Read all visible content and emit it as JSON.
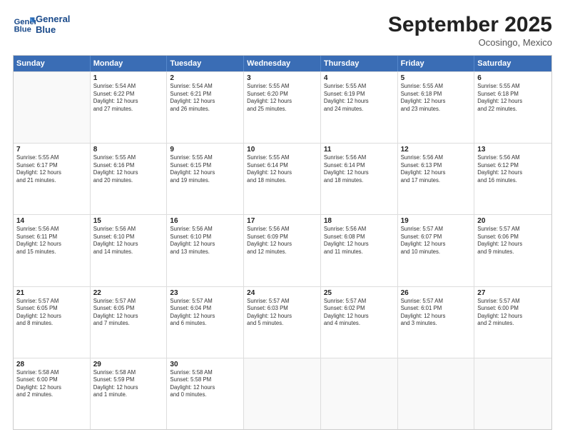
{
  "header": {
    "logo_line1": "General",
    "logo_line2": "Blue",
    "month": "September 2025",
    "location": "Ocosingo, Mexico"
  },
  "days_of_week": [
    "Sunday",
    "Monday",
    "Tuesday",
    "Wednesday",
    "Thursday",
    "Friday",
    "Saturday"
  ],
  "weeks": [
    [
      {
        "day": "",
        "info": ""
      },
      {
        "day": "1",
        "info": "Sunrise: 5:54 AM\nSunset: 6:22 PM\nDaylight: 12 hours\nand 27 minutes."
      },
      {
        "day": "2",
        "info": "Sunrise: 5:54 AM\nSunset: 6:21 PM\nDaylight: 12 hours\nand 26 minutes."
      },
      {
        "day": "3",
        "info": "Sunrise: 5:55 AM\nSunset: 6:20 PM\nDaylight: 12 hours\nand 25 minutes."
      },
      {
        "day": "4",
        "info": "Sunrise: 5:55 AM\nSunset: 6:19 PM\nDaylight: 12 hours\nand 24 minutes."
      },
      {
        "day": "5",
        "info": "Sunrise: 5:55 AM\nSunset: 6:18 PM\nDaylight: 12 hours\nand 23 minutes."
      },
      {
        "day": "6",
        "info": "Sunrise: 5:55 AM\nSunset: 6:18 PM\nDaylight: 12 hours\nand 22 minutes."
      }
    ],
    [
      {
        "day": "7",
        "info": "Sunrise: 5:55 AM\nSunset: 6:17 PM\nDaylight: 12 hours\nand 21 minutes."
      },
      {
        "day": "8",
        "info": "Sunrise: 5:55 AM\nSunset: 6:16 PM\nDaylight: 12 hours\nand 20 minutes."
      },
      {
        "day": "9",
        "info": "Sunrise: 5:55 AM\nSunset: 6:15 PM\nDaylight: 12 hours\nand 19 minutes."
      },
      {
        "day": "10",
        "info": "Sunrise: 5:55 AM\nSunset: 6:14 PM\nDaylight: 12 hours\nand 18 minutes."
      },
      {
        "day": "11",
        "info": "Sunrise: 5:56 AM\nSunset: 6:14 PM\nDaylight: 12 hours\nand 18 minutes."
      },
      {
        "day": "12",
        "info": "Sunrise: 5:56 AM\nSunset: 6:13 PM\nDaylight: 12 hours\nand 17 minutes."
      },
      {
        "day": "13",
        "info": "Sunrise: 5:56 AM\nSunset: 6:12 PM\nDaylight: 12 hours\nand 16 minutes."
      }
    ],
    [
      {
        "day": "14",
        "info": "Sunrise: 5:56 AM\nSunset: 6:11 PM\nDaylight: 12 hours\nand 15 minutes."
      },
      {
        "day": "15",
        "info": "Sunrise: 5:56 AM\nSunset: 6:10 PM\nDaylight: 12 hours\nand 14 minutes."
      },
      {
        "day": "16",
        "info": "Sunrise: 5:56 AM\nSunset: 6:10 PM\nDaylight: 12 hours\nand 13 minutes."
      },
      {
        "day": "17",
        "info": "Sunrise: 5:56 AM\nSunset: 6:09 PM\nDaylight: 12 hours\nand 12 minutes."
      },
      {
        "day": "18",
        "info": "Sunrise: 5:56 AM\nSunset: 6:08 PM\nDaylight: 12 hours\nand 11 minutes."
      },
      {
        "day": "19",
        "info": "Sunrise: 5:57 AM\nSunset: 6:07 PM\nDaylight: 12 hours\nand 10 minutes."
      },
      {
        "day": "20",
        "info": "Sunrise: 5:57 AM\nSunset: 6:06 PM\nDaylight: 12 hours\nand 9 minutes."
      }
    ],
    [
      {
        "day": "21",
        "info": "Sunrise: 5:57 AM\nSunset: 6:05 PM\nDaylight: 12 hours\nand 8 minutes."
      },
      {
        "day": "22",
        "info": "Sunrise: 5:57 AM\nSunset: 6:05 PM\nDaylight: 12 hours\nand 7 minutes."
      },
      {
        "day": "23",
        "info": "Sunrise: 5:57 AM\nSunset: 6:04 PM\nDaylight: 12 hours\nand 6 minutes."
      },
      {
        "day": "24",
        "info": "Sunrise: 5:57 AM\nSunset: 6:03 PM\nDaylight: 12 hours\nand 5 minutes."
      },
      {
        "day": "25",
        "info": "Sunrise: 5:57 AM\nSunset: 6:02 PM\nDaylight: 12 hours\nand 4 minutes."
      },
      {
        "day": "26",
        "info": "Sunrise: 5:57 AM\nSunset: 6:01 PM\nDaylight: 12 hours\nand 3 minutes."
      },
      {
        "day": "27",
        "info": "Sunrise: 5:57 AM\nSunset: 6:00 PM\nDaylight: 12 hours\nand 2 minutes."
      }
    ],
    [
      {
        "day": "28",
        "info": "Sunrise: 5:58 AM\nSunset: 6:00 PM\nDaylight: 12 hours\nand 2 minutes."
      },
      {
        "day": "29",
        "info": "Sunrise: 5:58 AM\nSunset: 5:59 PM\nDaylight: 12 hours\nand 1 minute."
      },
      {
        "day": "30",
        "info": "Sunrise: 5:58 AM\nSunset: 5:58 PM\nDaylight: 12 hours\nand 0 minutes."
      },
      {
        "day": "",
        "info": ""
      },
      {
        "day": "",
        "info": ""
      },
      {
        "day": "",
        "info": ""
      },
      {
        "day": "",
        "info": ""
      }
    ]
  ]
}
